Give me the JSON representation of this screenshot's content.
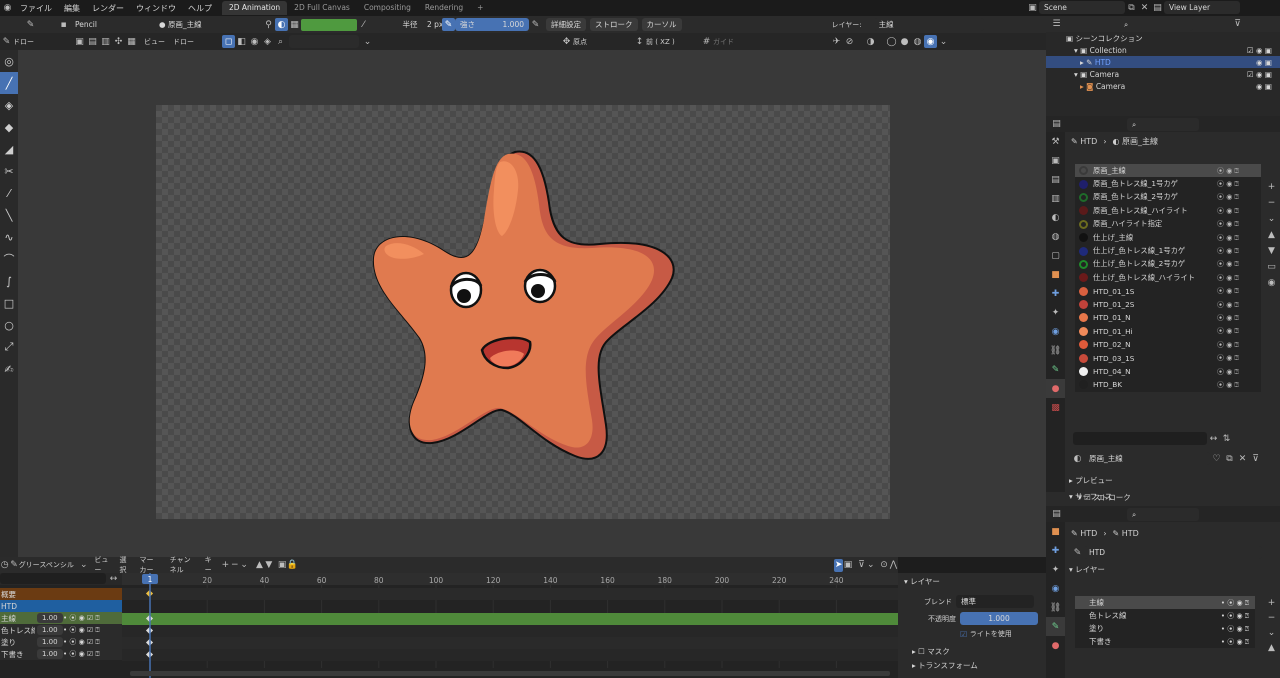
{
  "menu": {
    "blender_icon": "blender-logo-icon",
    "items": [
      "ファイル",
      "編集",
      "レンダー",
      "ウィンドウ",
      "ヘルプ"
    ]
  },
  "workspaces": [
    "2D Animation",
    "2D Full Canvas",
    "Compositing",
    "Rendering",
    "+"
  ],
  "scene": {
    "label": "Scene",
    "view_layer": "View Layer"
  },
  "toolheader": {
    "brush": "Pencil",
    "material": "原画_主線",
    "strength_label": "半径",
    "radius_value": "2 px",
    "strength_name": "強さ",
    "strength_value": "1.000",
    "advanced": "詳細設定",
    "stroke": "ストローク",
    "cursor": "カーソル",
    "layer_label": "レイヤー:",
    "layer_value": "主線"
  },
  "viewheader": {
    "mode": "ドロー",
    "view": "ビュー",
    "draw": "ドロー",
    "origin": "原点",
    "front": "前 ( XZ )",
    "guide": "ガイド"
  },
  "outliner": {
    "title": "シーンコレクション",
    "items": [
      {
        "label": "Collection",
        "indent": 1
      },
      {
        "label": "HTD",
        "indent": 2,
        "selected": true
      },
      {
        "label": "Camera",
        "indent": 1
      },
      {
        "label": "Camera",
        "indent": 2
      }
    ]
  },
  "material_panel": {
    "breadcrumb1": "HTD",
    "breadcrumb2": "原画_主線",
    "materials": [
      {
        "name": "原画_主線",
        "color": "#3a3a3a",
        "ring": true,
        "selected": true
      },
      {
        "name": "原画_色トレス線_1号カゲ",
        "color": "#1f1f6b"
      },
      {
        "name": "原画_色トレス線_2号カゲ",
        "color": "#1f6b2a",
        "ring": true
      },
      {
        "name": "原画_色トレス線_ハイライト",
        "color": "#5a1a1a"
      },
      {
        "name": "原画_ハイライト指定",
        "color": "#6b6b1f",
        "ring": true
      },
      {
        "name": "仕上げ_主線",
        "color": "#111111"
      },
      {
        "name": "仕上げ_色トレス線_1号カゲ",
        "color": "#1f2a7a"
      },
      {
        "name": "仕上げ_色トレス線_2号カゲ",
        "color": "#1f8a2a",
        "ring": true
      },
      {
        "name": "仕上げ_色トレス線_ハイライト",
        "color": "#6b1a1a"
      },
      {
        "name": "HTD_01_1S",
        "color": "#d9603f"
      },
      {
        "name": "HTD_01_2S",
        "color": "#c0423a"
      },
      {
        "name": "HTD_01_N",
        "color": "#e8774a"
      },
      {
        "name": "HTD_01_Hi",
        "color": "#f08a5a"
      },
      {
        "name": "HTD_02_N",
        "color": "#e05a3a"
      },
      {
        "name": "HTD_03_1S",
        "color": "#c84a3a"
      },
      {
        "name": "HTD_04_N",
        "color": "#f0f0f0"
      },
      {
        "name": "HTD_BK",
        "color": "#202020"
      }
    ],
    "active_material": "原画_主線",
    "preview": "プレビュー",
    "surface": "サーフェス",
    "stroke": "ストローク"
  },
  "layer_panel": {
    "breadcrumb1": "HTD",
    "breadcrumb2": "HTD",
    "data_name": "HTD",
    "section": "レイヤー",
    "layers": [
      "主線",
      "色トレス線",
      "塗り",
      "下書き"
    ]
  },
  "timeline": {
    "editor": "グリースペンシル",
    "menus": [
      "ビュー",
      "選択",
      "マーカー",
      "チャンネル",
      "キー"
    ],
    "current_frame": "1",
    "ticks": [
      "20",
      "40",
      "60",
      "80",
      "100",
      "120",
      "140",
      "160",
      "180",
      "200",
      "220",
      "240"
    ],
    "channels": [
      {
        "name": "概要"
      },
      {
        "name": "HTD"
      },
      {
        "name": "主線",
        "value": "1.00"
      },
      {
        "name": "色トレス線",
        "value": "1.00"
      },
      {
        "name": "塗り",
        "value": "1.00"
      },
      {
        "name": "下書き",
        "value": "1.00"
      }
    ]
  },
  "layer_props": {
    "section": "レイヤー",
    "blend_label": "ブレンド",
    "blend_value": "標準",
    "opacity_label": "不透明度",
    "opacity_value": "1.000",
    "use_lights": "ライトを使用",
    "mask": "マスク",
    "transform": "トランスフォーム"
  },
  "colors": {
    "accent": "#4772b3",
    "star_fill": "#e07a4f",
    "star_shadow": "#c75a45",
    "star_highlight": "#f28f5e",
    "keyframe_green": "#4f8a3a"
  }
}
